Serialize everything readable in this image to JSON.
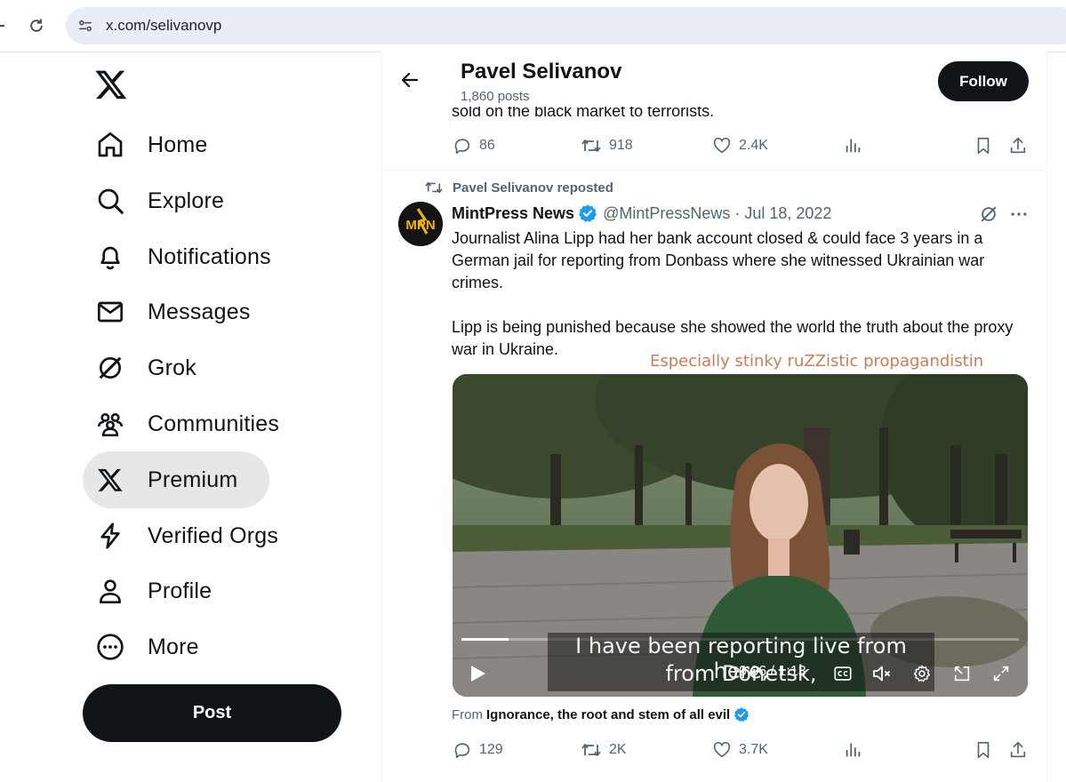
{
  "browser": {
    "url": "x.com/selivanovp"
  },
  "sidebar": {
    "items": [
      {
        "label": "Home",
        "icon": "home-icon"
      },
      {
        "label": "Explore",
        "icon": "search-icon"
      },
      {
        "label": "Notifications",
        "icon": "bell-icon"
      },
      {
        "label": "Messages",
        "icon": "envelope-icon"
      },
      {
        "label": "Grok",
        "icon": "grok-icon"
      },
      {
        "label": "Communities",
        "icon": "people-icon"
      },
      {
        "label": "Premium",
        "icon": "x-logo-icon"
      },
      {
        "label": "Verified Orgs",
        "icon": "lightning-icon"
      },
      {
        "label": "Profile",
        "icon": "person-icon"
      },
      {
        "label": "More",
        "icon": "more-circle-icon"
      }
    ],
    "active": "Premium",
    "post_label": "Post"
  },
  "header": {
    "name": "Pavel Selivanov",
    "posts": "1,860 posts",
    "follow_label": "Follow"
  },
  "prev_tweet": {
    "peek_text": "sold on the black market to terrorists.",
    "replies": "86",
    "reposts": "918",
    "likes": "2.4K"
  },
  "tweet": {
    "repost_label": "Pavel Selivanov reposted",
    "author": "MintPress News",
    "handle": "@MintPressNews",
    "separator": "·",
    "date": "Jul 18, 2022",
    "avatar_text": "MPN",
    "paragraph1": "Journalist Alina Lipp had her bank account closed & could face 3 years in a German jail for reporting from Donbass where she witnessed Ukrainian war crimes.",
    "paragraph2": "Lipp is being punished because she showed the world the truth about the proxy war in Ukraine.",
    "overlay_caption": "Especially stinky ruZZistic propagandistin",
    "video": {
      "subtitle_line1": "I have been reporting live from here,",
      "subtitle_line2": "from Donetsk,",
      "time": "0:06 / 1:13",
      "progress": 0.085
    },
    "from_prefix": "From",
    "from_name": "Ignorance, the root and stem of all evil",
    "replies": "129",
    "reposts": "2K",
    "likes": "3.7K"
  },
  "colors": {
    "text": "#0f1419",
    "muted": "#536471",
    "verified": "#1d9bf0",
    "overlay": "#c97e57"
  }
}
